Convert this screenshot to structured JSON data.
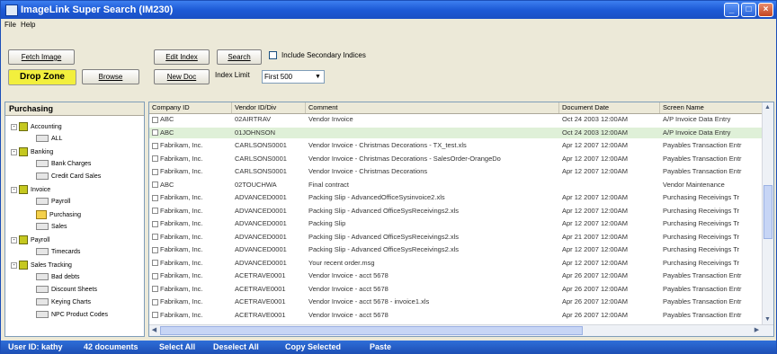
{
  "window": {
    "title": "ImageLink Super Search (IM230)"
  },
  "menu": {
    "file": "File",
    "help": "Help"
  },
  "toolbar": {
    "fetch_image": "Fetch Image",
    "drop_zone": "Drop Zone",
    "browse": "Browse",
    "edit_index": "Edit Index",
    "search": "Search",
    "include_secondary": "Include Secondary Indices",
    "new_doc": "New Doc",
    "index_limit_label": "Index Limit",
    "index_limit_value": "First 500"
  },
  "tree": {
    "header": "Purchasing",
    "nodes": [
      "Accounting",
      "ALL",
      "Banking",
      "Bank Charges",
      "Credit Card Sales",
      "Invoice",
      "Payroll",
      "Purchasing",
      "Sales",
      "Payroll",
      "Timecards",
      "Sales Tracking",
      "Bad debts",
      "Discount Sheets",
      "Keying Charts",
      "NPC Product Codes"
    ]
  },
  "grid": {
    "columns": [
      "Company ID",
      "Vendor ID/Div",
      "Comment",
      "Document Date",
      "Screen Name"
    ],
    "rows": [
      [
        "ABC",
        "02AIRTRAV",
        "Vendor Invoice",
        "Oct 24 2003 12:00AM",
        "A/P Invoice Data Entry"
      ],
      [
        "ABC",
        "01JOHNSON",
        "",
        "Oct 24 2003 12:00AM",
        "A/P Invoice Data Entry"
      ],
      [
        "Fabrikam, Inc.",
        "CARLSONS0001",
        "Vendor Invoice - Christmas Decorations - TX_test.xls",
        "Apr 12 2007 12:00AM",
        "Payables Transaction Entr"
      ],
      [
        "Fabrikam, Inc.",
        "CARLSONS0001",
        "Vendor Invoice - Christmas Decorations - SalesOrder-OrangeDo",
        "Apr 12 2007 12:00AM",
        "Payables Transaction Entr"
      ],
      [
        "Fabrikam, Inc.",
        "CARLSONS0001",
        "Vendor Invoice - Christmas Decorations",
        "Apr 12 2007 12:00AM",
        "Payables Transaction Entr"
      ],
      [
        "ABC",
        "02TOUCHWA",
        "Final contract",
        "",
        "Vendor Maintenance"
      ],
      [
        "Fabrikam, Inc.",
        "ADVANCED0001",
        "Packing Slip - AdvancedOfficeSysinvoice2.xls",
        "Apr 12 2007 12:00AM",
        "Purchasing Receivings Tr"
      ],
      [
        "Fabrikam, Inc.",
        "ADVANCED0001",
        "Packing Slip - Advanced OfficeSysReceivings2.xls",
        "Apr 12 2007 12:00AM",
        "Purchasing Receivings Tr"
      ],
      [
        "Fabrikam, Inc.",
        "ADVANCED0001",
        "Packing Slip",
        "Apr 12 2007 12:00AM",
        "Purchasing Receivings Tr"
      ],
      [
        "Fabrikam, Inc.",
        "ADVANCED0001",
        "Packing Slip - Advanced OfficeSysReceivings2.xls",
        "Apr 21 2007 12:00AM",
        "Purchasing Receivings Tr"
      ],
      [
        "Fabrikam, Inc.",
        "ADVANCED0001",
        "Packing Slip - Advanced OfficeSysReceivings2.xls",
        "Apr 12 2007 12:00AM",
        "Purchasing Receivings Tr"
      ],
      [
        "Fabrikam, Inc.",
        "ADVANCED0001",
        "Your recent order.msg",
        "Apr 12 2007 12:00AM",
        "Purchasing Receivings Tr"
      ],
      [
        "Fabrikam, Inc.",
        "ACETRAVE0001",
        "Vendor Invoice - acct 5678",
        "Apr 26 2007 12:00AM",
        "Payables Transaction Entr"
      ],
      [
        "Fabrikam, Inc.",
        "ACETRAVE0001",
        "Vendor Invoice - acct 5678",
        "Apr 26 2007 12:00AM",
        "Payables Transaction Entr"
      ],
      [
        "Fabrikam, Inc.",
        "ACETRAVE0001",
        "Vendor Invoice - acct 5678 - invoice1.xls",
        "Apr 26 2007 12:00AM",
        "Payables Transaction Entr"
      ],
      [
        "Fabrikam, Inc.",
        "ACETRAVE0001",
        "Vendor Invoice - acct 5678",
        "Apr 26 2007 12:00AM",
        "Payables Transaction Entr"
      ]
    ]
  },
  "status": {
    "user": "User ID: kathy",
    "count": "42 documents",
    "select_all": "Select All",
    "deselect_all": "Deselect All",
    "copy_selected": "Copy Selected",
    "paste": "Paste"
  }
}
